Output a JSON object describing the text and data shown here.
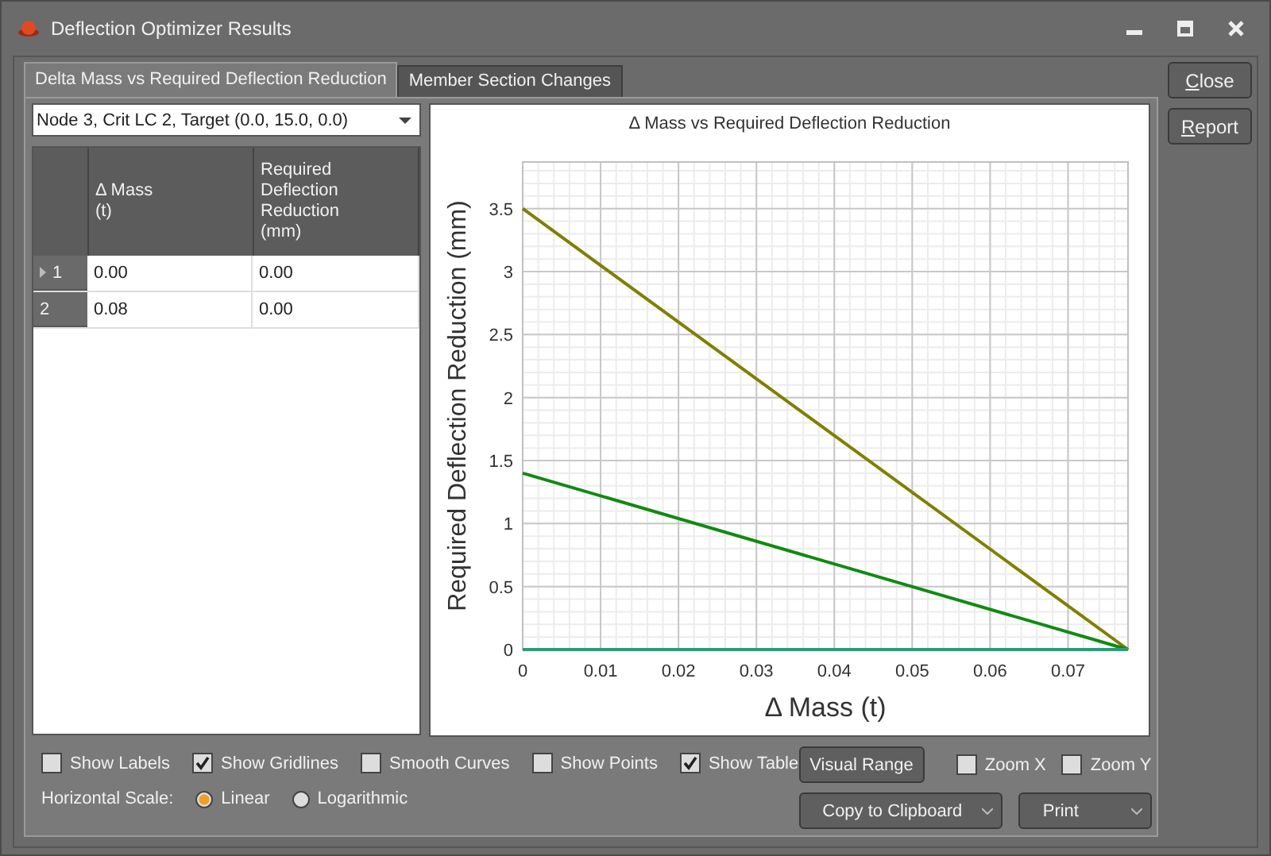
{
  "window": {
    "title": "Deflection Optimizer Results"
  },
  "tabs": [
    {
      "label": "Delta Mass vs Required Deflection Reduction",
      "selected": true
    },
    {
      "label": "Member Section Changes",
      "selected": false
    }
  ],
  "selector": {
    "value": "Node 3, Crit LC 2, Target (0.0, 15.0, 0.0)"
  },
  "table": {
    "columns": [
      "Δ Mass\n(t)",
      "Required\nDeflection\nReduction\n(mm)"
    ],
    "rows": [
      {
        "header": "1",
        "selected": true,
        "cells": [
          "0.00",
          "0.00"
        ]
      },
      {
        "header": "2",
        "selected": false,
        "cells": [
          "0.08",
          "0.00"
        ]
      }
    ]
  },
  "chart_data": {
    "type": "line",
    "title": "Δ Mass vs Required Deflection Reduction",
    "xlabel": "Δ Mass (t)",
    "ylabel": "Required Deflection Reduction (mm)",
    "x": [
      0,
      0.0777
    ],
    "series": [
      {
        "color": "#7f7f00",
        "values": [
          3.5,
          0
        ]
      },
      {
        "color": "#118a11",
        "values": [
          1.4,
          0
        ]
      },
      {
        "color": "#2e9a7a",
        "values": [
          0,
          0
        ]
      }
    ],
    "grid": true,
    "xlim": [
      0,
      0.0777
    ],
    "ylim": [
      0,
      3.87
    ],
    "xticks": [
      0,
      0.01,
      0.02,
      0.03,
      0.04,
      0.05,
      0.06,
      0.07
    ],
    "yticks": [
      0,
      0.5,
      1,
      1.5,
      2,
      2.5,
      3,
      3.5
    ]
  },
  "options": [
    {
      "kind": "checkbox",
      "label": "Show Labels",
      "checked": false
    },
    {
      "kind": "checkbox",
      "label": "Show Gridlines",
      "checked": true
    },
    {
      "kind": "checkbox",
      "label": "Smooth Curves",
      "checked": false
    },
    {
      "kind": "checkbox",
      "label": "Show Points",
      "checked": false
    },
    {
      "kind": "checkbox",
      "label": "Show Table",
      "checked": true
    }
  ],
  "scale": {
    "label": "Horizontal Scale:",
    "choices": [
      {
        "label": "Linear",
        "selected": true
      },
      {
        "label": "Logarithmic",
        "selected": false
      }
    ]
  },
  "visual_range": "Visual Range",
  "zoom": [
    {
      "label": "Zoom X",
      "checked": false
    },
    {
      "label": "Zoom Y",
      "checked": false
    }
  ],
  "copy_button": "Copy to Clipboard",
  "print_button": "Print",
  "side_buttons": [
    {
      "label": "Close"
    },
    {
      "label": "Report"
    }
  ]
}
